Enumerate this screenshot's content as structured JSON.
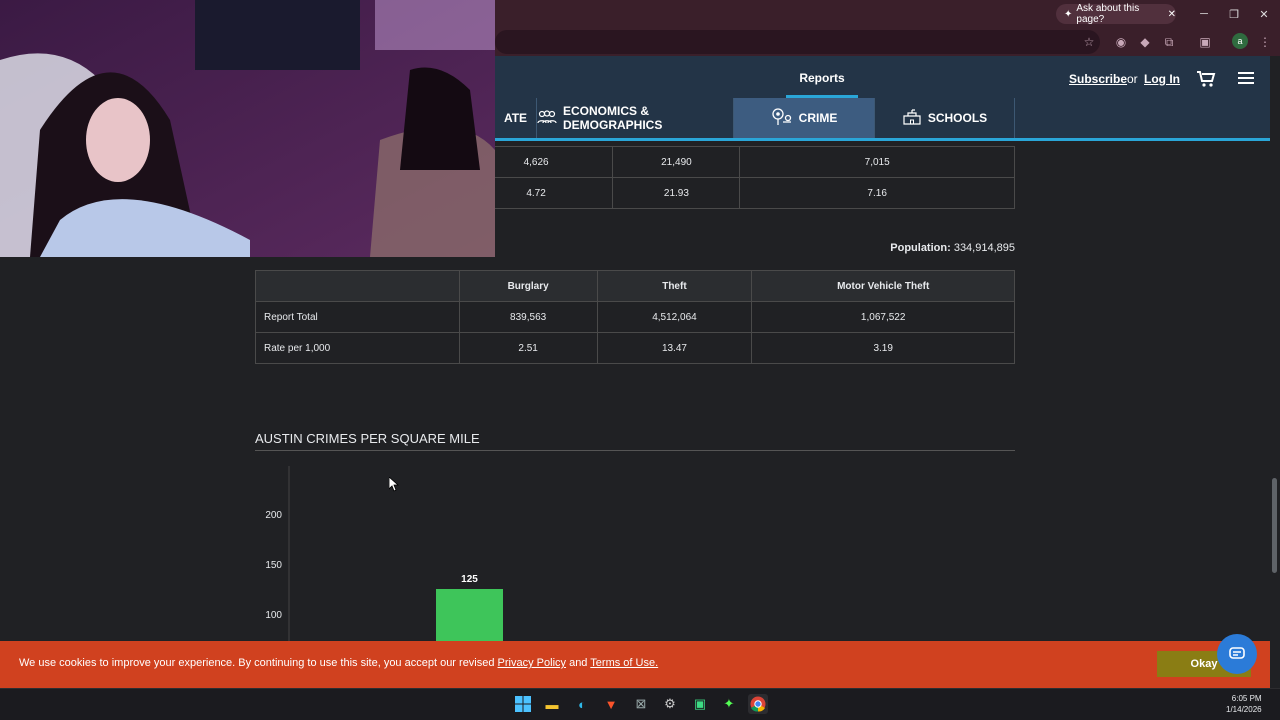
{
  "browser": {
    "ask_label": "Ask about this page?",
    "window_buttons": [
      "─",
      "❐",
      "✕"
    ]
  },
  "site": {
    "nav_reports": "Reports",
    "subscribe": "Subscribe",
    "or": "or",
    "login": "Log In",
    "tabs": [
      {
        "label": "ATE"
      },
      {
        "label": "ECONOMICS & DEMOGRAPHICS"
      },
      {
        "label": "CRIME"
      },
      {
        "label": "SCHOOLS"
      }
    ]
  },
  "table1": {
    "rows": [
      [
        "4,626",
        "21,490",
        "7,015"
      ],
      [
        "4.72",
        "21.93",
        "7.16"
      ]
    ]
  },
  "population": {
    "label": "Population:",
    "value": " 334,914,895"
  },
  "table2": {
    "headers": [
      "",
      "Burglary",
      "Theft",
      "Motor Vehicle Theft"
    ],
    "rows": [
      [
        "Report Total",
        "839,563",
        "4,512,064",
        "1,067,522"
      ],
      [
        "Rate per 1,000",
        "2.51",
        "13.47",
        "3.19"
      ]
    ]
  },
  "chart_title": "AUSTIN CRIMES PER SQUARE MILE",
  "chart_data": {
    "type": "bar",
    "categories": [
      ""
    ],
    "values": [
      125
    ],
    "data_labels": [
      "125"
    ],
    "yticks": [
      100,
      150,
      200
    ],
    "ylim": [
      0,
      230
    ],
    "bar_color": "#3ec55a"
  },
  "cookie": {
    "text_before": "We use cookies to improve your experience. By continuing to use this site, you accept our revised ",
    "privacy": "Privacy Policy",
    "and": " and ",
    "terms": "Terms of Use.",
    "okay": "Okay"
  },
  "clock": {
    "time": "6:05 PM",
    "date": "1/14/2026"
  },
  "colors": {
    "header": "#233447",
    "accent": "#2aa6d8",
    "cookie": "#d0411f"
  }
}
